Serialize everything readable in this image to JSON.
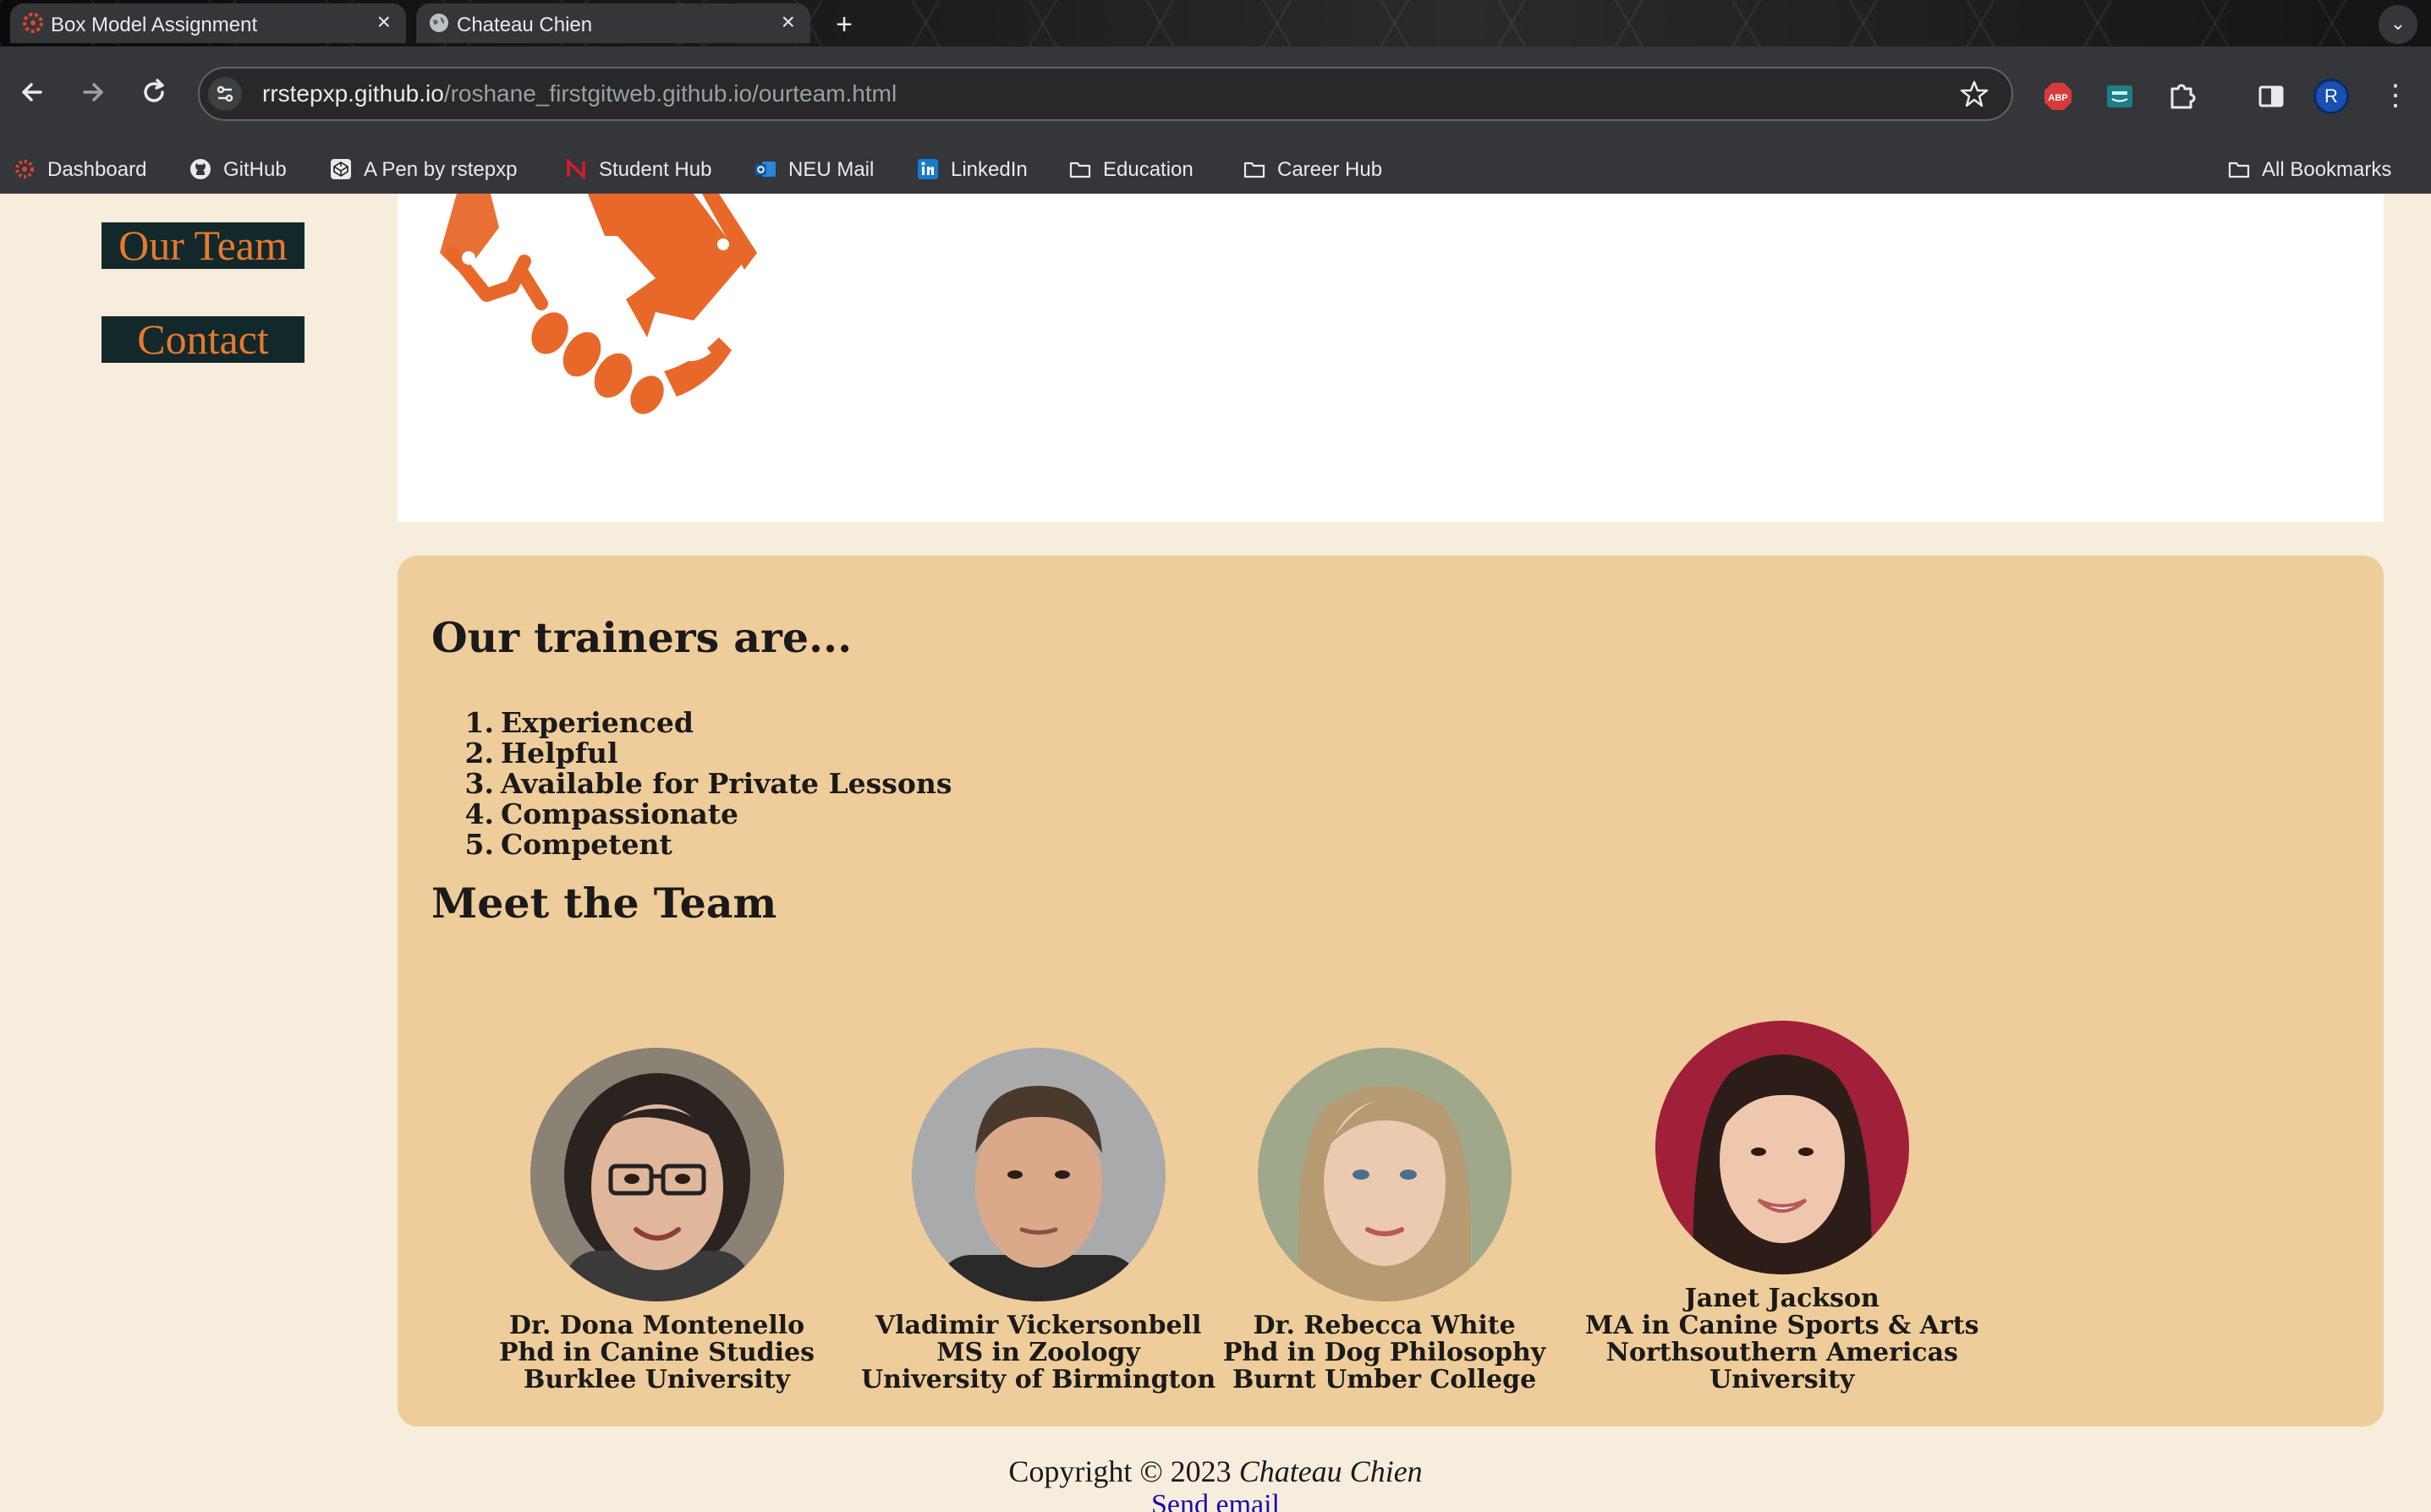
{
  "browser": {
    "tabs": [
      {
        "title": "Box Model Assignment",
        "active": false
      },
      {
        "title": "Chateau Chien",
        "active": true
      }
    ],
    "url": {
      "host": "rrstepxp.github.io",
      "path": "/roshane_firstgitweb.github.io/ourteam.html"
    },
    "extensions": [
      "abp-icon",
      "amazon-extension-icon",
      "puzzle-icon",
      "side-panel-icon"
    ],
    "profile_initial": "R",
    "bookmarks": [
      {
        "label": "Dashboard",
        "icon": "canvas-icon"
      },
      {
        "label": "GitHub",
        "icon": "github-icon"
      },
      {
        "label": "A Pen by rstepxp",
        "icon": "codepen-icon"
      },
      {
        "label": "Student Hub",
        "icon": "northeastern-icon"
      },
      {
        "label": "NEU Mail",
        "icon": "outlook-icon"
      },
      {
        "label": "LinkedIn",
        "icon": "linkedin-icon"
      },
      {
        "label": "Education",
        "icon": "folder-icon"
      },
      {
        "label": "Career Hub",
        "icon": "folder-icon"
      }
    ],
    "all_bookmarks": "All Bookmarks"
  },
  "sidebar": {
    "links": [
      {
        "label": "Our Team"
      },
      {
        "label": "Contact"
      }
    ]
  },
  "main": {
    "trainers_heading": "Our trainers are...",
    "traits": [
      {
        "num": "1.",
        "text": "Experienced"
      },
      {
        "num": "2.",
        "text": "Helpful"
      },
      {
        "num": "3.",
        "text": "Available for Private Lessons"
      },
      {
        "num": "4.",
        "text": "Compassionate"
      },
      {
        "num": "5.",
        "text": "Competent"
      }
    ],
    "team_heading": "Meet the Team",
    "team": [
      {
        "lines": [
          "Dr. Dona Montenello",
          "Phd in Canine Studies",
          "Burklee University"
        ],
        "skin": "#e0b79a",
        "hair": "#2b2320",
        "bg": "#8a8275",
        "glasses": true
      },
      {
        "lines": [
          "Vladimir Vickersonbell",
          "MS in Zoology",
          "University of Birmington"
        ],
        "skin": "#d9a98a",
        "hair": "#4a3a2c",
        "bg": "#a9aaac",
        "glasses": false
      },
      {
        "lines": [
          "Dr. Rebecca White",
          "Phd in Dog Philosophy",
          "Burnt Umber College"
        ],
        "skin": "#eccab0",
        "hair": "#b59a72",
        "bg": "#9fa88a",
        "glasses": false
      },
      {
        "lines": [
          "Janet Jackson",
          "MA in Canine Sports & Arts",
          "Northsouthern Americas",
          "University"
        ],
        "skin": "#efc7ad",
        "hair": "#2c1d19",
        "bg": "#a0203a",
        "glasses": false
      }
    ]
  },
  "footer": {
    "copyright": "Copyright © 2023",
    "brand": "Chateau Chien",
    "email_link": "Send email"
  },
  "colors": {
    "page_bg": "#f7eddc",
    "card_bg": "#eecd9a",
    "nav_bg": "#13282b",
    "nav_text": "#e57a2e",
    "logo_orange": "#e8682a"
  }
}
